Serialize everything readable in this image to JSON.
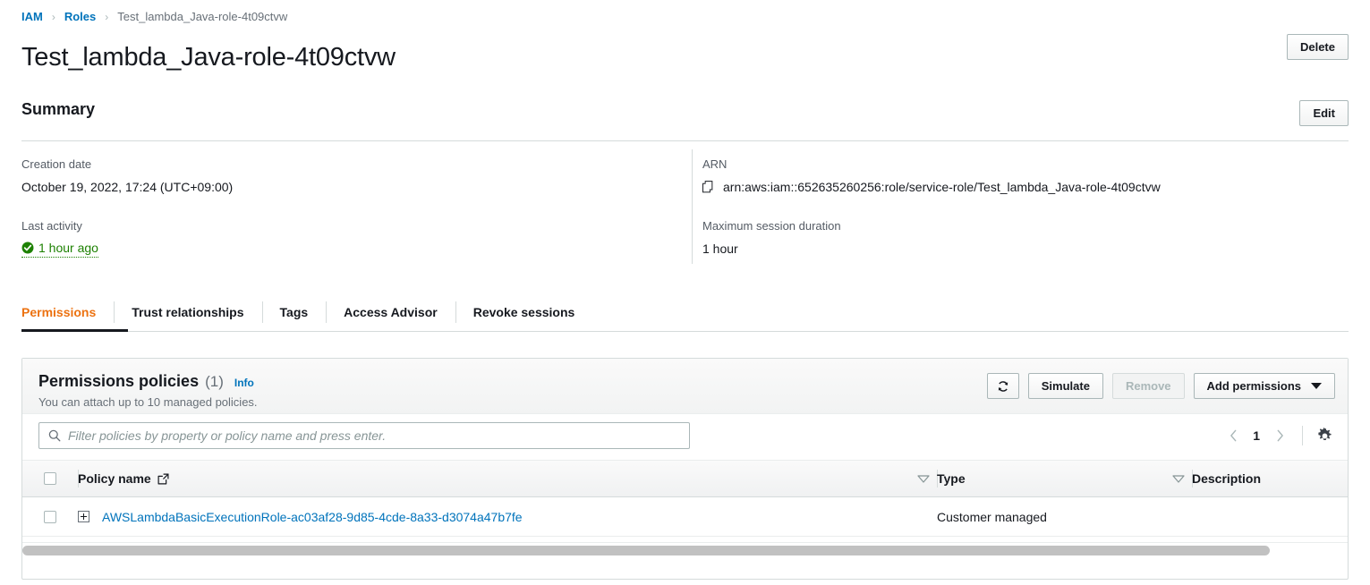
{
  "breadcrumb": {
    "items": [
      {
        "label": "IAM",
        "type": "link"
      },
      {
        "label": "Roles",
        "type": "link"
      },
      {
        "label": "Test_lambda_Java-role-4t09ctvw",
        "type": "current"
      }
    ],
    "separator": "›"
  },
  "page": {
    "title": "Test_lambda_Java-role-4t09ctvw",
    "delete_label": "Delete",
    "edit_label": "Edit"
  },
  "summary": {
    "heading": "Summary",
    "creation_date_label": "Creation date",
    "creation_date_value": "October 19, 2022, 17:24 (UTC+09:00)",
    "last_activity_label": "Last activity",
    "last_activity_value": "1 hour ago",
    "last_activity_color": "#1d8102",
    "arn_label": "ARN",
    "arn_value": "arn:aws:iam::652635260256:role/service-role/Test_lambda_Java-role-4t09ctvw",
    "max_session_label": "Maximum session duration",
    "max_session_value": "1 hour"
  },
  "tabs": {
    "active_color": "#ec7211",
    "items": [
      {
        "label": "Permissions",
        "active": true
      },
      {
        "label": "Trust relationships",
        "active": false
      },
      {
        "label": "Tags",
        "active": false
      },
      {
        "label": "Access Advisor",
        "active": false
      },
      {
        "label": "Revoke sessions",
        "active": false
      }
    ]
  },
  "permissions_panel": {
    "title": "Permissions policies",
    "count": "(1)",
    "info_label": "Info",
    "subtitle": "You can attach up to 10 managed policies.",
    "refresh_label": "",
    "simulate_label": "Simulate",
    "remove_label": "Remove",
    "remove_disabled": true,
    "add_permissions_label": "Add permissions",
    "filter_placeholder": "Filter policies by property or policy name and press enter.",
    "filter_value": "",
    "page_number": "1",
    "columns": [
      "Policy name",
      "Type",
      "Description"
    ],
    "rows": [
      {
        "policy_name": "AWSLambdaBasicExecutionRole-ac03af28-9d85-4cde-8a33-d3074a47b7fe",
        "type": "Customer managed",
        "description": ""
      }
    ]
  }
}
